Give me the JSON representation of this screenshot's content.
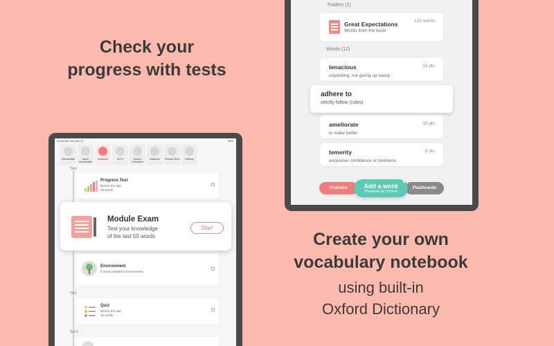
{
  "left_promo": {
    "line1": "Check your",
    "line2": "progress with tests"
  },
  "right_promo": {
    "line1": "Create your own",
    "line2": "vocabulary notebook",
    "sub1": "using built-in",
    "sub2": "Oxford Dictionary"
  },
  "notebook": {
    "folders_label": "Folders (1)",
    "folder": {
      "title": "Great Expectations",
      "desc": "Words from the book",
      "count": "120 words"
    },
    "words_label": "Words (12)",
    "words": [
      {
        "title": "tenacious",
        "desc": "unyielding; not giving up easily",
        "pts": "15 pts"
      },
      {
        "title": "adhere to",
        "desc": "strictly follow (rules)",
        "pts": ""
      },
      {
        "title": "ameliorate",
        "desc": "to make better",
        "pts": "15 pts"
      },
      {
        "title": "temerity",
        "desc": "excessive confidence or boldness",
        "pts": "6 pts"
      }
    ],
    "practice_label": "Practice",
    "add_label": "Add a word",
    "add_plus": "+",
    "powered_label": "Powered by Oxford",
    "flashcards_label": "Flashcards"
  },
  "tests_screen": {
    "status_time": "10:46 AM Tue Dec 22",
    "status_battery": "98%",
    "toolbar": [
      {
        "label": "Intermediate",
        "icon": "level-icon"
      },
      {
        "label": "Upper Intermediate",
        "icon": "level-icon"
      },
      {
        "label": "Advanced",
        "icon": "level-icon"
      },
      {
        "label": "IELTS",
        "icon": "exam-icon"
      },
      {
        "label": "Modern Collocation",
        "icon": "person-icon"
      },
      {
        "label": "Business",
        "icon": "chart-icon"
      },
      {
        "label": "Phrasal Verbs",
        "icon": "grid-icon"
      },
      {
        "label": "Settings",
        "icon": "gear-icon"
      }
    ],
    "progress_section_label": "Test",
    "progress_test": {
      "title": "Progress Test",
      "desc1": "Revise the last",
      "desc2": "25 words"
    },
    "module_exam": {
      "title": "Module Exam",
      "desc1": "Test your knowledge",
      "desc2": "of the last 50 words",
      "start": "Start"
    },
    "environment": {
      "title": "Environment",
      "desc": "5 words related to environment"
    },
    "quiz_section_label": "Test",
    "quiz": {
      "title": "Quiz",
      "desc1": "Revise the last",
      "desc2": "16 words"
    },
    "set_label": "Set 8",
    "colors": {
      "accent": "#f47d7b",
      "teal": "#5ecab4",
      "background": "#fdbaaf"
    }
  }
}
